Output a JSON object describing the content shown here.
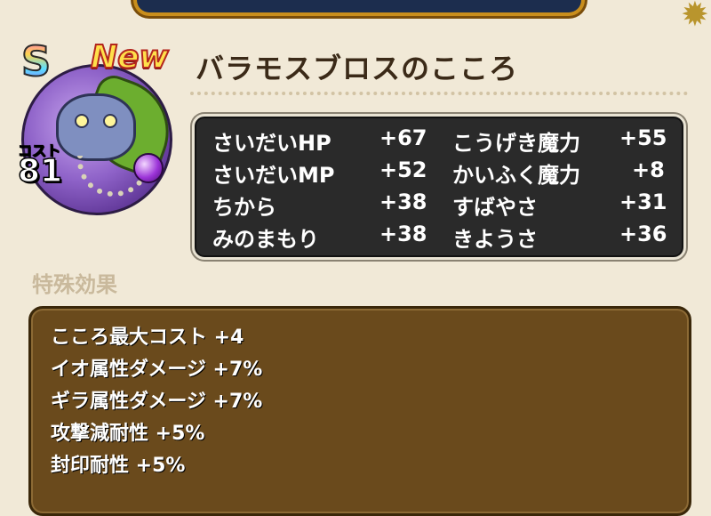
{
  "card": {
    "rank": "S",
    "new_badge": "New",
    "name": "バラモスブロスのこころ",
    "cost_label": "コスト",
    "cost_value": "81"
  },
  "stats": {
    "left": [
      {
        "label": "さいだいHP",
        "value": "+67"
      },
      {
        "label": "さいだいMP",
        "value": "+52"
      },
      {
        "label": "ちから",
        "value": "+38"
      },
      {
        "label": "みのまもり",
        "value": "+38"
      }
    ],
    "right": [
      {
        "label": "こうげき魔力",
        "value": "+55"
      },
      {
        "label": "かいふく魔力",
        "value": "+8"
      },
      {
        "label": "すばやさ",
        "value": "+31"
      },
      {
        "label": "きようさ",
        "value": "+36"
      }
    ]
  },
  "special": {
    "title": "特殊効果",
    "effects": [
      "こころ最大コスト +4",
      "イオ属性ダメージ +7%",
      "ギラ属性ダメージ +7%",
      "攻撃減耐性 +5%",
      "封印耐性 +5%"
    ]
  },
  "colors": {
    "background": "#f1e9d7",
    "stats_panel": "#2a2a2a",
    "effects_panel": "#6a4a1c",
    "title_text": "#3b2a18",
    "section_title": "#c9b99c"
  },
  "icons": {
    "orb": "monster-portrait-icon",
    "jewel": "purple-orb-icon",
    "corner": "gear-ornament-icon"
  }
}
